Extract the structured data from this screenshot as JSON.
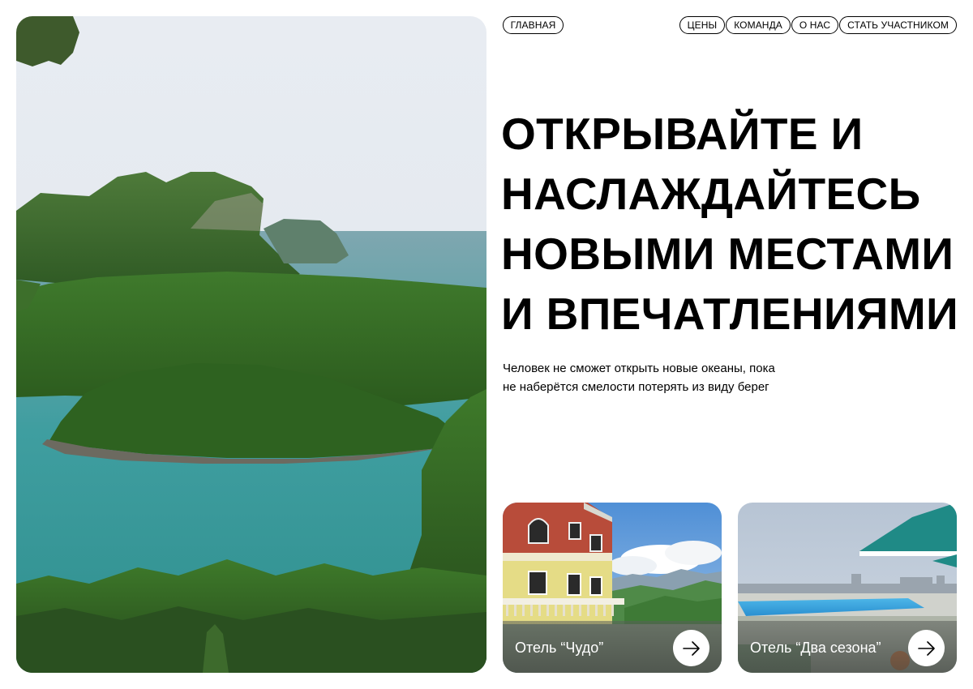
{
  "nav": {
    "home": "ГЛАВНАЯ",
    "items": [
      {
        "label": "ЦЕНЫ"
      },
      {
        "label": "КОМАНДА"
      },
      {
        "label": "О НАС"
      },
      {
        "label": "СТАТЬ УЧАСТНИКОМ"
      }
    ]
  },
  "hero": {
    "headline_lines": [
      "ОТКРЫВАЙТЕ И",
      "НАСЛАЖДАЙТЕСЬ",
      "НОВЫМИ МЕСТАМИ",
      "И ВПЕЧАТЛЕНИЯМИ"
    ],
    "lead_lines": [
      "Человек не сможет открыть новые океаны, пока",
      "не наберётся смелости потерять из виду берег"
    ],
    "image": "tropical-islands-bay-photo"
  },
  "hotels": [
    {
      "name": "Отель “Чудо”",
      "image": "hotel-building-mountains-photo",
      "icon": "arrow-right-icon"
    },
    {
      "name": "Отель “Два сезона”",
      "image": "hotel-pool-terrace-photo",
      "icon": "arrow-right-icon"
    }
  ],
  "colors": {
    "text": "#000000",
    "background": "#ffffff",
    "card_label": "#ffffff"
  }
}
